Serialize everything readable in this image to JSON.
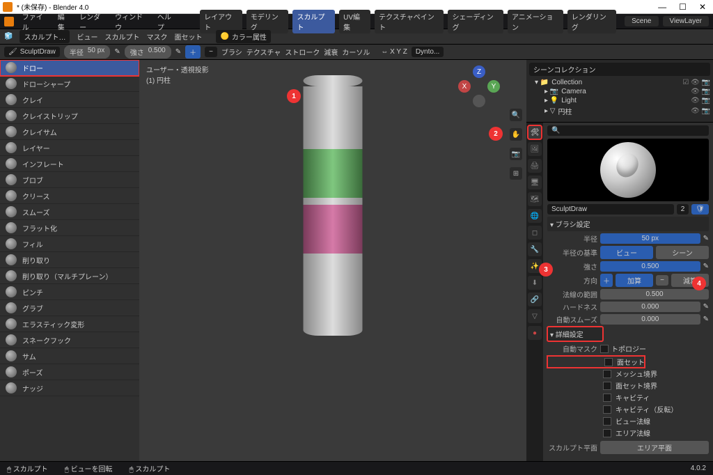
{
  "title": "* (未保存) - Blender 4.0",
  "menu": {
    "items": [
      "ファイル",
      "編集",
      "レンダー",
      "ウィンドウ",
      "ヘルプ"
    ]
  },
  "workspaces": [
    "レイアウト",
    "モデリング",
    "スカルプト",
    "UV編集",
    "テクスチャペイント",
    "シェーディング",
    "アニメーション",
    "レンダリング"
  ],
  "scene": {
    "label": "Scene",
    "layer": "ViewLayer"
  },
  "hdr2": {
    "mode": "スカルプト…",
    "items": [
      "ビュー",
      "スカルプト",
      "マスク",
      "面セット"
    ],
    "color": "カラー属性"
  },
  "hdr3": {
    "field": "SculptDraw",
    "radius_l": "半径",
    "radius_v": "50 px",
    "strength_l": "強さ",
    "strength_v": "0.500",
    "brush": "ブラシ",
    "tex": "テクスチャ",
    "stroke": "ストローク",
    "falloff": "減衰",
    "cursor": "カーソル",
    "dyn": "Dynto..."
  },
  "brushes": [
    "ドロー",
    "ドローシャープ",
    "クレイ",
    "クレイストリップ",
    "クレイサム",
    "レイヤー",
    "インフレート",
    "ブロブ",
    "クリース",
    "スムーズ",
    "フラット化",
    "フィル",
    "削り取り",
    "削り取り（マルチプレーン）",
    "ピンチ",
    "グラブ",
    "エラスティック変形",
    "スネークフック",
    "サム",
    "ポーズ",
    "ナッジ"
  ],
  "vp": {
    "l1": "ユーザー・透視投影",
    "l2": "(1) 円柱",
    "gizmo": [
      "Z",
      "X",
      "Y"
    ]
  },
  "outliner": {
    "search": "シーンコレクション",
    "coll": "Collection",
    "items": [
      "Camera",
      "Light",
      "円柱"
    ]
  },
  "props": {
    "name": "SculptDraw",
    "users": "2",
    "section1": "ブラシ設定",
    "radius": "半径",
    "radius_v": "50 px",
    "radius_base": "半径の基準",
    "view": "ビュー",
    "scene_": "シーン",
    "strength": "強さ",
    "strength_v": "0.500",
    "direction": "方向",
    "add": "加算",
    "sub": "減算",
    "normal": "法線の範囲",
    "normal_v": "0.500",
    "hardness": "ハードネス",
    "hardness_v": "0.000",
    "autosmooth": "自動スムーズ",
    "autosmooth_v": "0.000",
    "advanced": "詳細設定",
    "automask": "自動マスク",
    "checks": [
      "トポロジー",
      "面セット",
      "メッシュ境界",
      "面セット境界",
      "キャビティ",
      "キャビティ（反転）",
      "ビュー法線",
      "エリア法線"
    ],
    "sculpt_plane": "スカルプト平面",
    "sculpt_plane_v": "エリア平面"
  },
  "footer": {
    "a": "スカルプト",
    "b": "ビューを回転",
    "c": "スカルプト",
    "ver": "4.0.2"
  }
}
